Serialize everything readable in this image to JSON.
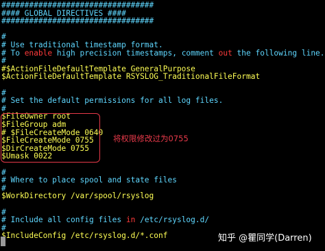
{
  "terminal": {
    "lines": [
      {
        "segs": [
          {
            "t": "comment",
            "v": "#################################"
          }
        ]
      },
      {
        "segs": [
          {
            "t": "comment",
            "v": "#### GLOBAL DIRECTIVES ####"
          }
        ]
      },
      {
        "segs": [
          {
            "t": "comment",
            "v": "#################################"
          }
        ]
      },
      {
        "segs": []
      },
      {
        "segs": [
          {
            "t": "comment",
            "v": "#"
          }
        ]
      },
      {
        "segs": [
          {
            "t": "comment",
            "v": "# Use traditional timestamp format."
          }
        ]
      },
      {
        "segs": [
          {
            "t": "comment",
            "v": "# To "
          },
          {
            "t": "keyword",
            "v": "enable"
          },
          {
            "t": "comment",
            "v": " high precision timestamps, comment "
          },
          {
            "t": "keyword",
            "v": "out"
          },
          {
            "t": "comment",
            "v": " the following line."
          }
        ]
      },
      {
        "segs": [
          {
            "t": "comment",
            "v": "#"
          }
        ]
      },
      {
        "segs": [
          {
            "t": "directive",
            "v": "#$ActionFileDefaultTemplate GeneralPurpose"
          }
        ]
      },
      {
        "segs": [
          {
            "t": "directive",
            "v": "$ActionFileDefaultTemplate RSYSLOG_TraditionalFileFormat"
          }
        ]
      },
      {
        "segs": []
      },
      {
        "segs": [
          {
            "t": "comment",
            "v": "#"
          }
        ]
      },
      {
        "segs": [
          {
            "t": "comment",
            "v": "# Set the default permissions for all log files."
          }
        ]
      },
      {
        "segs": [
          {
            "t": "comment",
            "v": "#"
          }
        ]
      },
      {
        "segs": [
          {
            "t": "directive",
            "v": "$FileOwner root"
          }
        ]
      },
      {
        "segs": [
          {
            "t": "directive",
            "v": "$FileGroup adm"
          }
        ]
      },
      {
        "segs": [
          {
            "t": "directive",
            "v": "# $FileCreateMode 0640"
          }
        ]
      },
      {
        "segs": [
          {
            "t": "directive",
            "v": "$FileCreateMode 0755"
          }
        ]
      },
      {
        "segs": [
          {
            "t": "directive",
            "v": "$DirCreateMode 0755"
          }
        ]
      },
      {
        "segs": [
          {
            "t": "directive",
            "v": "$Umask 0022"
          }
        ]
      },
      {
        "segs": []
      },
      {
        "segs": [
          {
            "t": "comment",
            "v": "#"
          }
        ]
      },
      {
        "segs": [
          {
            "t": "comment",
            "v": "# Where to place spool and state files"
          }
        ]
      },
      {
        "segs": [
          {
            "t": "comment",
            "v": "#"
          }
        ]
      },
      {
        "segs": [
          {
            "t": "directive",
            "v": "$WorkDirectory /var/spool/rsyslog"
          }
        ]
      },
      {
        "segs": []
      },
      {
        "segs": [
          {
            "t": "comment",
            "v": "#"
          }
        ]
      },
      {
        "segs": [
          {
            "t": "comment",
            "v": "# Include all config files "
          },
          {
            "t": "keyword",
            "v": "in"
          },
          {
            "t": "comment",
            "v": " /etc/rsyslog.d/"
          }
        ]
      },
      {
        "segs": [
          {
            "t": "comment",
            "v": "#"
          }
        ]
      },
      {
        "segs": [
          {
            "t": "directive",
            "v": "$IncludeConfig /etc/rsyslog.d/*.conf"
          }
        ]
      }
    ]
  },
  "annotation": {
    "text": "将权限修改过为0755"
  },
  "watermark": {
    "text": "知乎 @瞿同学(Darren)"
  },
  "colors": {
    "background": "#000000",
    "comment": "#5fd7ff",
    "keyword": "#ff3b3b",
    "directive": "#ffff55",
    "annotation": "#e83a4a"
  }
}
